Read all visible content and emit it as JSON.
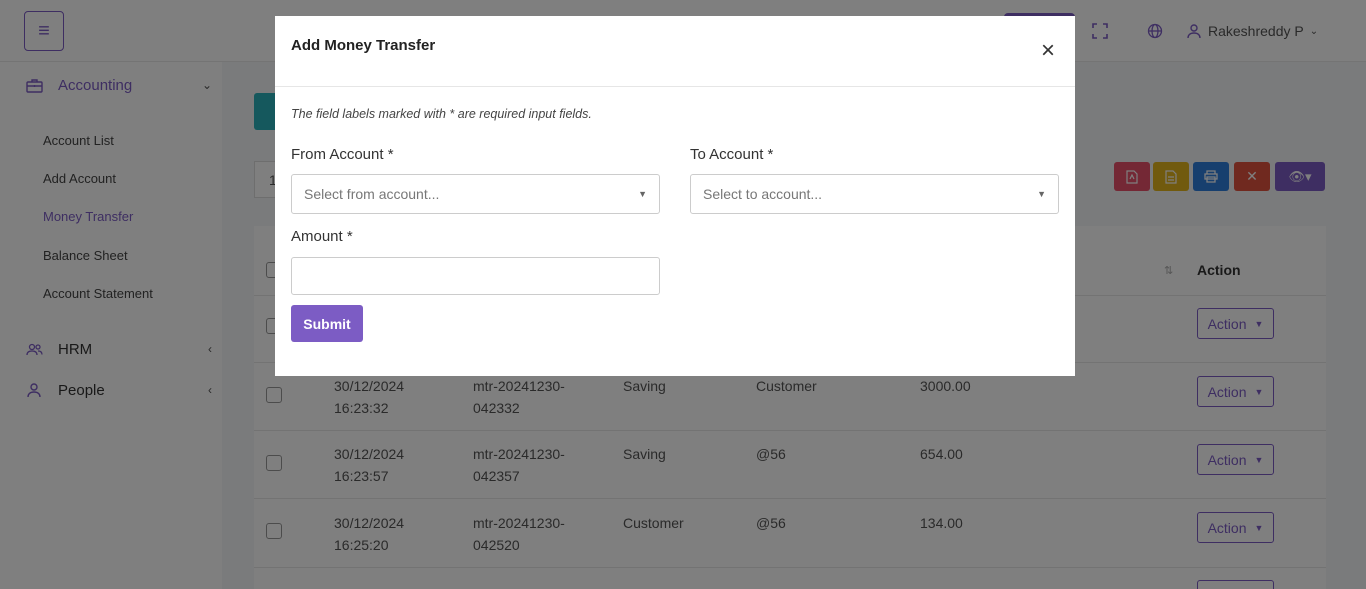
{
  "header": {
    "menu_icon": "hamburger-icon",
    "fullscreen_icon": "expand-icon",
    "language_icon": "globe-icon",
    "user_icon": "user-icon",
    "user_name": "Rakeshreddy P"
  },
  "sidebar": {
    "sections": [
      {
        "label": "Accounting",
        "icon": "briefcase-icon",
        "expanded": true
      },
      {
        "label": "HRM",
        "icon": "users-icon",
        "expanded": false
      },
      {
        "label": "People",
        "icon": "user-icon",
        "expanded": false
      }
    ],
    "accounting_items": [
      {
        "label": "Account List"
      },
      {
        "label": "Add Account"
      },
      {
        "label": "Money Transfer"
      },
      {
        "label": "Balance Sheet"
      },
      {
        "label": "Account Statement"
      }
    ],
    "active_item": "Money Transfer"
  },
  "pager_first_digit": "1",
  "table": {
    "action_header": "Action",
    "action_label": "Action",
    "rows": [
      {
        "date": "30/12/2024",
        "time": "16:23:32",
        "ref_a": "mtr-20241230-",
        "ref_b": "042332",
        "from": "Saving",
        "to": "Customer",
        "amount": "3000.00"
      },
      {
        "date": "30/12/2024",
        "time": "16:23:57",
        "ref_a": "mtr-20241230-",
        "ref_b": "042357",
        "from": "Saving",
        "to": "@56",
        "amount": "654.00"
      },
      {
        "date": "30/12/2024",
        "time": "16:25:20",
        "ref_a": "mtr-20241230-",
        "ref_b": "042520",
        "from": "Customer",
        "to": "@56",
        "amount": "134.00"
      }
    ]
  },
  "colors": {
    "accent": "#7c5cc4",
    "pdf": "#e8506a",
    "csv": "#e3b51d",
    "print": "#2f7fdc",
    "delete": "#e0523f",
    "column_toggle": "#7c5cc4"
  },
  "modal": {
    "title": "Add Money Transfer",
    "required_note": "The field labels marked with * are required input fields.",
    "from_label": "From Account *",
    "from_placeholder": "Select from account...",
    "to_label": "To Account *",
    "to_placeholder": "Select to account...",
    "amount_label": "Amount *",
    "amount_value": "",
    "submit_label": "Submit"
  }
}
